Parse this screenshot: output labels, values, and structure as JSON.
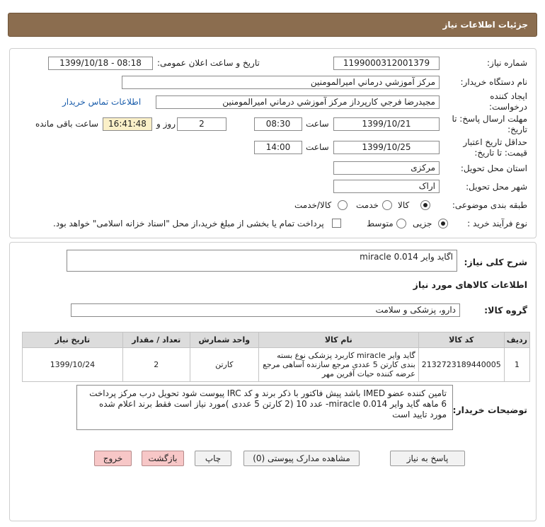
{
  "header": {
    "title": "جزئیات اطلاعات نیاز"
  },
  "form": {
    "need_number_label": "شماره نیاز:",
    "need_number": "1199000312001379",
    "announce_label": "تاریخ و ساعت اعلان عمومی:",
    "announce_value": "1399/10/18 - 08:18",
    "buyer_org_label": "نام دستگاه خریدار:",
    "buyer_org": "مرکز آموزشي درماني اميرالمومنين",
    "creator_label": "ایجاد کننده درخواست:",
    "creator": "مجیدرضا فرجي كارپرداز مرکز آموزشي درماني اميرالمومنين",
    "contact_link": "اطلاعات تماس خریدار",
    "reply_deadline_label": "مهلت ارسال پاسخ: تا تاریخ:",
    "reply_date": "1399/10/21",
    "time_label": "ساعت",
    "reply_time": "08:30",
    "days_value": "2",
    "days_label": "روز و",
    "remaining_time": "16:41:48",
    "remaining_label": "ساعت باقی مانده",
    "validity_label": "حداقل تاریخ اعتبار قیمت: تا تاریخ:",
    "validity_date": "1399/10/25",
    "validity_time_label": "ساعت",
    "validity_time": "14:00",
    "province_label": "استان محل تحویل:",
    "province": "مرکزی",
    "city_label": "شهر محل تحویل:",
    "city": "اراک",
    "category_label": "طبقه بندی موضوعی:",
    "category_options": [
      "کالا",
      "خدمت",
      "کالا/خدمت"
    ],
    "purchase_type_label": "نوع فرآیند خرید :",
    "purchase_options": [
      "جزیی",
      "متوسط"
    ],
    "payment_note": "پرداخت تمام یا بخشی از مبلغ خرید،از محل \"اسناد خزانه اسلامی\" خواهد بود."
  },
  "details": {
    "summary_label": "شرح کلی نیاز:",
    "summary": "اگاید وایر miracle  0.014",
    "goods_info_label": "اطلاعات کالاهای مورد نیاز",
    "group_label": "گروه کالا:",
    "group": "دارو، پزشکی و سلامت",
    "table": {
      "headers": [
        "ردیف",
        "کد کالا",
        "نام کالا",
        "واحد شمارش",
        "تعداد / مقدار",
        "تاریخ نیاز"
      ],
      "rows": [
        {
          "index": "1",
          "code": "2132723189440005",
          "name": "گاید وایر miracle کاربرد پزشکی نوع بسته بندی کارتن 5 عددی مرجع سازنده آساهی مرجع عرضه کننده حیات آفرین مهر",
          "unit": "کارتن",
          "qty": "2",
          "date": "1399/10/24"
        }
      ]
    },
    "notes_label": "توضیحات خریدار:",
    "notes": "تامین کننده عضو IMED باشد پیش فاکتور با ذکر برند و کد IRC پیوست شود تحویل درب مرکز پرداخت 6 ماهه  گاید وایر miracle  0.014-   عدد 10  (2 کارتن 5 عددی )مورد نیاز است فقط برند اعلام شده مورد تایید است"
  },
  "buttons": {
    "reply": "پاسخ به نیاز",
    "attachments": "مشاهده مدارک پیوستی (0)",
    "print": "چاپ",
    "back": "بازگشت",
    "exit": "خروج"
  }
}
